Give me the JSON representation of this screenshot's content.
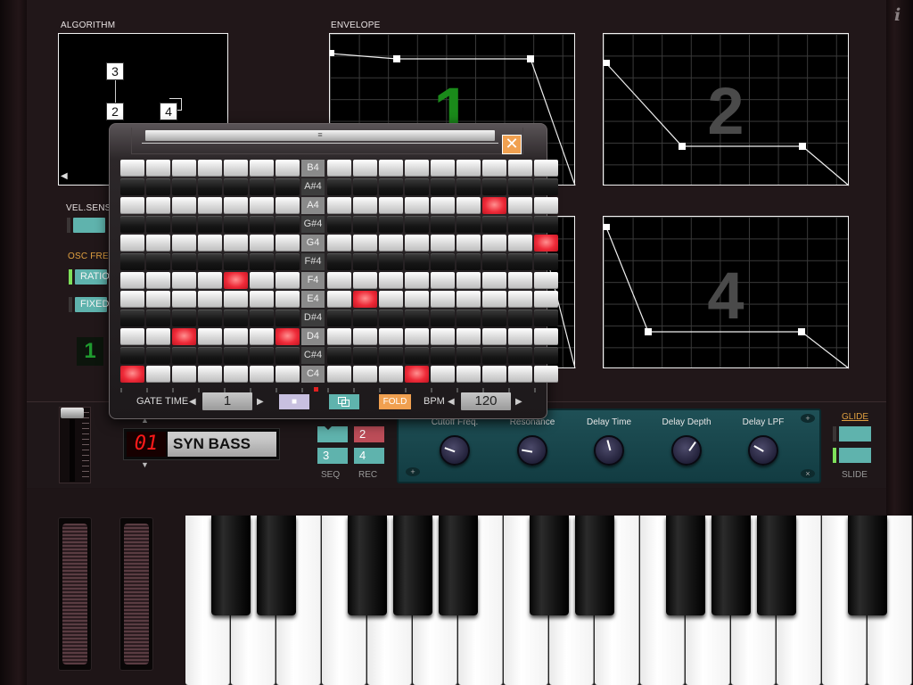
{
  "info_icon": "i",
  "algorithm": {
    "label": "ALGORITHM",
    "operators": [
      "3",
      "2",
      "4"
    ],
    "back_arrow": "◀"
  },
  "envelope": {
    "label": "ENVELOPE",
    "panels": [
      "1",
      "2",
      "4"
    ]
  },
  "vel_sens": {
    "label": "VEL.SENS"
  },
  "osc_freq": {
    "label": "OSC FREQ",
    "ratio_label": "RATIO",
    "fixed_label": "FIXED",
    "value": "1"
  },
  "sequencer": {
    "notes": [
      "B4",
      "A#4",
      "A4",
      "G#4",
      "G4",
      "F#4",
      "F4",
      "E4",
      "D#4",
      "D4",
      "C#4",
      "C4"
    ],
    "steps": 16,
    "active": [
      {
        "note": "A4",
        "step": 14
      },
      {
        "note": "G4",
        "step": 16
      },
      {
        "note": "F4",
        "step": 5
      },
      {
        "note": "E4",
        "step": 9
      },
      {
        "note": "D4",
        "step": 3
      },
      {
        "note": "D4",
        "step": 7
      },
      {
        "note": "C4",
        "step": 1
      },
      {
        "note": "C4",
        "step": 11
      }
    ],
    "gate_time_label": "GATE TIME",
    "gate_time_value": "1",
    "stop_symbol": "■",
    "fold_label": "FOLD",
    "bpm_label": "BPM",
    "bpm_value": "120",
    "close_symbol": "✕",
    "left_arrow": "◀",
    "right_arrow": "▶"
  },
  "program": {
    "number": "01",
    "name": "SYN BASS"
  },
  "seq_buttons": {
    "btn2": "2",
    "btn3": "3",
    "btn4": "4",
    "seq_label": "SEQ",
    "rec_label": "REC"
  },
  "effects": {
    "knobs": [
      {
        "label": "Cutoff Freq.",
        "angle": -70
      },
      {
        "label": "Resonance",
        "angle": -80
      },
      {
        "label": "Delay Time",
        "angle": -15
      },
      {
        "label": "Delay Depth",
        "angle": 35
      },
      {
        "label": "Delay LPF",
        "angle": -60
      }
    ]
  },
  "glide": {
    "label": "GLIDE",
    "slide_label": "SLIDE"
  },
  "colors": {
    "accent_teal": "#5fb3ad",
    "note_on_red": "#ee2a38",
    "fold_orange": "#f0a050",
    "led_green": "#7ee05a",
    "rec_red": "#bc4d58"
  }
}
